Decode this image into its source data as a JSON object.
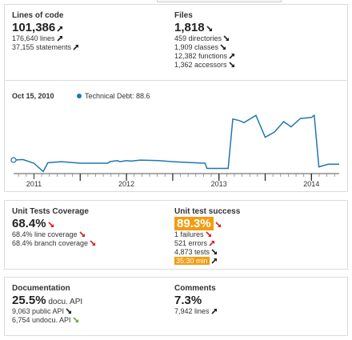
{
  "size": {
    "lines_of_code": {
      "title": "Lines of code",
      "value": "101,386",
      "value_trend": "up",
      "lines": "176,640 lines",
      "lines_trend": "up",
      "statements": "37,155 statements",
      "statements_trend": "up"
    },
    "files": {
      "title": "Files",
      "value": "1,818",
      "value_trend": "down",
      "directories": "459 directories",
      "directories_trend": "down",
      "classes": "1,909 classes",
      "classes_trend": "down",
      "functions": "12,382 functions",
      "functions_trend": "up",
      "accessors": "1,362 accessors",
      "accessors_trend": "down"
    }
  },
  "timeline": {
    "date": "Oct 15, 2010",
    "legend_label": "Technical Debt: 88.6",
    "color": "#1f77b4"
  },
  "chart_data": {
    "type": "line",
    "series": [
      {
        "name": "Technical Debt",
        "points": [
          [
            2010.78,
            88.6
          ],
          [
            2010.88,
            88.7
          ],
          [
            2011.0,
            88.0
          ],
          [
            2011.1,
            86.4
          ],
          [
            2011.15,
            88.1
          ],
          [
            2011.3,
            88.3
          ],
          [
            2011.5,
            88.0
          ],
          [
            2011.8,
            88.0
          ],
          [
            2011.82,
            88.3
          ],
          [
            2011.9,
            88.5
          ],
          [
            2011.93,
            88.3
          ],
          [
            2012.0,
            88.5
          ],
          [
            2012.05,
            88.4
          ],
          [
            2012.15,
            88.6
          ],
          [
            2012.35,
            88.5
          ],
          [
            2012.5,
            88.3
          ],
          [
            2012.85,
            88.0
          ],
          [
            2012.87,
            87.0
          ],
          [
            2013.1,
            87.0
          ],
          [
            2013.15,
            96.5
          ],
          [
            2013.22,
            96.2
          ],
          [
            2013.27,
            95.8
          ],
          [
            2013.4,
            97.2
          ],
          [
            2013.5,
            93.0
          ],
          [
            2013.6,
            94.0
          ],
          [
            2013.7,
            96.0
          ],
          [
            2013.78,
            95.0
          ],
          [
            2013.88,
            96.6
          ],
          [
            2014.0,
            96.8
          ],
          [
            2014.03,
            97.2
          ],
          [
            2014.08,
            87.3
          ],
          [
            2014.18,
            87.8
          ],
          [
            2014.3,
            87.8
          ]
        ]
      }
    ],
    "xticks": [
      "2011",
      "2012",
      "2013",
      "2014"
    ],
    "xtick_values": [
      2011,
      2012,
      2013,
      2014
    ],
    "xlim": [
      2010.78,
      2014.3
    ],
    "ylim": [
      86,
      98
    ],
    "event_markers": [
      2011.5,
      2012.0,
      2012.5,
      2013.0,
      2013.5,
      2014.0
    ]
  },
  "tests": {
    "coverage": {
      "title": "Unit Tests Coverage",
      "value": "68.4%",
      "value_trend": "down",
      "line": "68.4% line coverage",
      "line_trend": "down",
      "branch": "68.4% branch coverage",
      "branch_trend": "down"
    },
    "success": {
      "title": "Unit test success",
      "value": "89.3%",
      "value_trend": "down",
      "failures": "1 failures",
      "failures_trend": "down",
      "errors": "521 errors",
      "errors_trend": "up",
      "tests": "4,873 tests",
      "tests_trend": "down",
      "duration": "35:30 min",
      "duration_trend": "up"
    }
  },
  "docs": {
    "documentation": {
      "title": "Documentation",
      "value": "25.5%",
      "unit": "docu. API",
      "public_api": "9,063 public API",
      "public_api_trend": "down",
      "undocu_api": "6,754 undocu. API",
      "undocu_api_trend": "down-good"
    },
    "comments": {
      "title": "Comments",
      "value": "7.3%",
      "lines": "7,942 lines",
      "lines_trend": "up"
    }
  }
}
